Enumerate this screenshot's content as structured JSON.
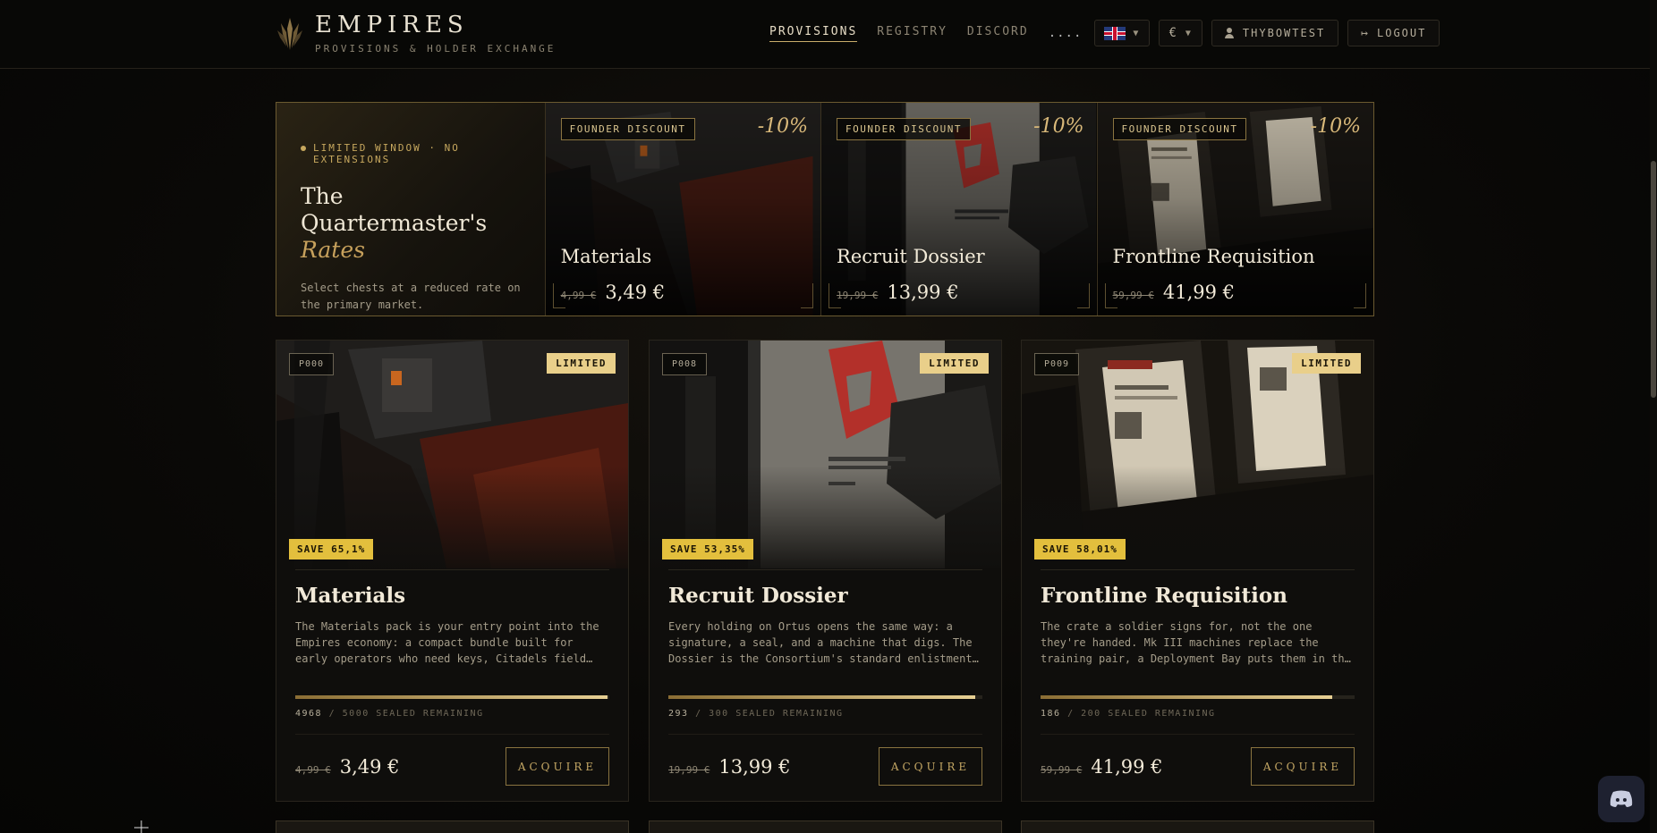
{
  "brand": {
    "title": "EMPIRES",
    "subtitle": "PROVISIONS & HOLDER EXCHANGE"
  },
  "nav": {
    "items": [
      {
        "label": "PROVISIONS",
        "active": true
      },
      {
        "label": "REGISTRY",
        "active": false
      },
      {
        "label": "DISCORD",
        "active": false
      }
    ],
    "more": "....",
    "currency": "€",
    "username": "THYBOWTEST",
    "logout": "LOGOUT"
  },
  "promo": {
    "kicker": "LIMITED WINDOW · NO EXTENSIONS",
    "title": "The Quartermaster's",
    "title_italic": "Rates",
    "description": "Select chests at a reduced rate on the primary market.",
    "cards": [
      {
        "badge": "FOUNDER DISCOUNT",
        "discount": "-10%",
        "name": "Materials",
        "old_price": "4,99 €",
        "new_price": "3,49 €"
      },
      {
        "badge": "FOUNDER DISCOUNT",
        "discount": "-10%",
        "name": "Recruit Dossier",
        "old_price": "19,99 €",
        "new_price": "13,99 €"
      },
      {
        "badge": "FOUNDER DISCOUNT",
        "discount": "-10%",
        "name": "Frontline Requisition",
        "old_price": "59,99 €",
        "new_price": "41,99 €"
      }
    ]
  },
  "products": [
    {
      "code": "P000",
      "tag": "LIMITED",
      "save": "SAVE 65,1%",
      "name": "Materials",
      "description": "The Materials pack is your entry point into the Empires economy: a compact bundle built for early operators who need keys, Citadels field caches, and a large stack of random crafting materials before…",
      "remaining": "4968",
      "total_label": "/ 5000 SEALED REMAINING",
      "fill": 0.994,
      "old_price": "4,99 €",
      "new_price": "3,49 €",
      "cta": "ACQUIRE"
    },
    {
      "code": "P008",
      "tag": "LIMITED",
      "save": "SAVE 53,35%",
      "name": "Recruit Dossier",
      "description": "Every holding on Ortus opens the same way: a signature, a seal, and a machine that digs. The Dossier is the Consortium's standard enlistment: a working AEV + AXV Mk II pair, five Order Permits t…",
      "remaining": "293",
      "total_label": "/ 300 SEALED REMAINING",
      "fill": 0.977,
      "old_price": "19,99 €",
      "new_price": "13,99 €",
      "cta": "ACQUIRE"
    },
    {
      "code": "P009",
      "tag": "LIMITED",
      "save": "SAVE 58,01%",
      "name": "Frontline Requisition",
      "description": "The crate a soldier signs for, not the one they're handed. Mk III machines replace the training pair, a Deployment Bay puts them in the field, and a Sentinel Frame stands over the dig. Fourteen Order…",
      "remaining": "186",
      "total_label": "/ 200 SEALED REMAINING",
      "fill": 0.93,
      "old_price": "59,99 €",
      "new_price": "41,99 €",
      "cta": "ACQUIRE"
    }
  ]
}
